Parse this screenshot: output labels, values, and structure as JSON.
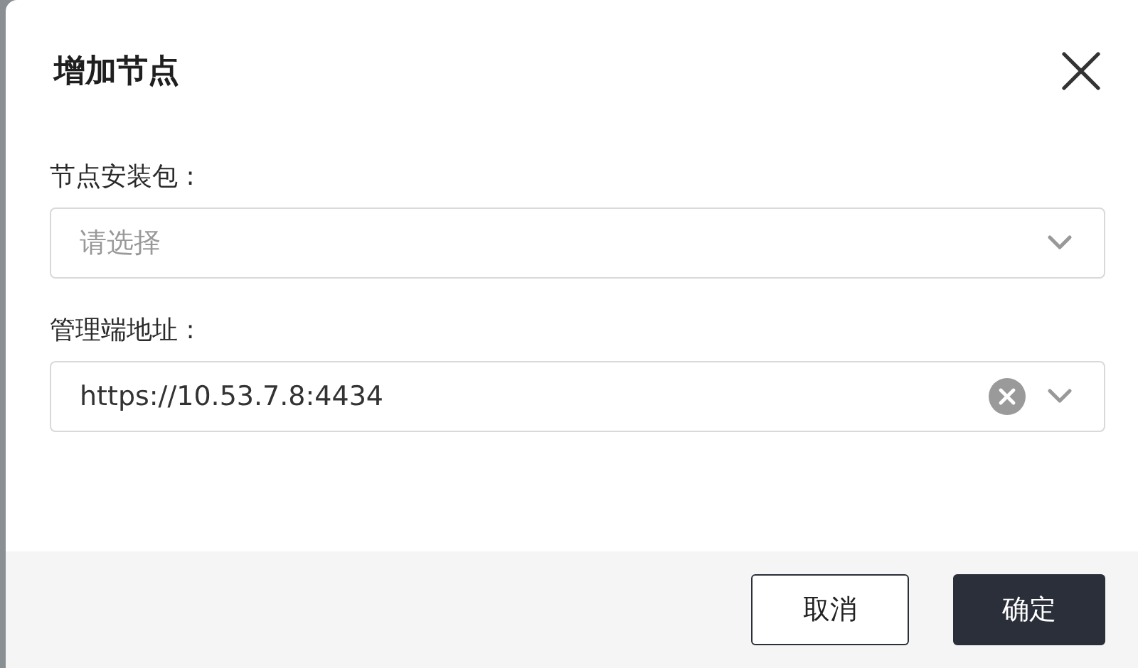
{
  "dialog": {
    "title": "增加节点"
  },
  "fields": [
    {
      "kind": "select",
      "label": "节点安装包 :",
      "placeholder": "请选择",
      "clearable": false
    },
    {
      "kind": "select",
      "label": "管理端地址 :",
      "value": "https://10.53.7.8:4434",
      "clearable": true
    }
  ],
  "buttons": [
    {
      "label": "取消",
      "primary": false
    },
    {
      "label": "确定",
      "primary": true
    }
  ]
}
